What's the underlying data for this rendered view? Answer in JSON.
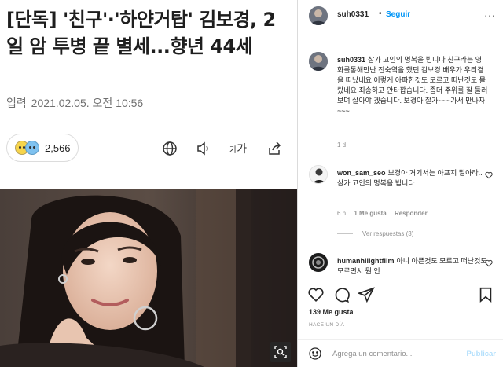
{
  "article": {
    "headline": "[단독] '친구'·'하얀거탑' 김보경, 2일 암 투병 끝 별세...향년 44세",
    "date_label": "입력",
    "date_value": "2021.02.05. 오전 10:56",
    "reaction_count": "2,566",
    "fontsize_label_big": "가",
    "fontsize_label_small": "가",
    "icons": [
      "globe-icon",
      "audio-icon",
      "font-size-icon",
      "share-icon",
      "zoom-icon"
    ]
  },
  "instagram": {
    "header": {
      "username": "suh0331",
      "dot": "•",
      "follow_label": "Seguir",
      "more": "..."
    },
    "caption": {
      "username": "suh0331",
      "text": "삼가 고인의 명복을 빕니다 친구라는 영화를통해만난 진숙역을 했던 김보경 배우가 우리곁을 떠났네요 이렇게 아파한것도 모르고 떠난것도 몰랐네요 죄송하고 안타깝습니다. 좀더 주위를 잘 둘러보며 살아야 겠습니다. 보경아 잘가~~~가서 만나자~~~",
      "time": "1 d"
    },
    "comments": [
      {
        "username": "won_sam_seo",
        "text": "보경아 거기서는 아프지 말아라.. 삼가 고인의 명복을 빕니다.",
        "time": "6 h",
        "likes": "1 Me gusta",
        "reply_label": "Responder",
        "view_replies": "Ver respuestas (3)"
      },
      {
        "username": "humanhilightfilm",
        "text": "아니 아픈것도 모르고 떠난것도 모르면서 뭔 인"
      }
    ],
    "likes_count": "139 Me gusta",
    "post_time": "HACE UN DÍA",
    "comment_placeholder": "Agrega un comentario...",
    "publish_label": "Publicar",
    "colors": {
      "link_blue": "#0095f6",
      "publish_disabled": "#b2dffc"
    }
  }
}
